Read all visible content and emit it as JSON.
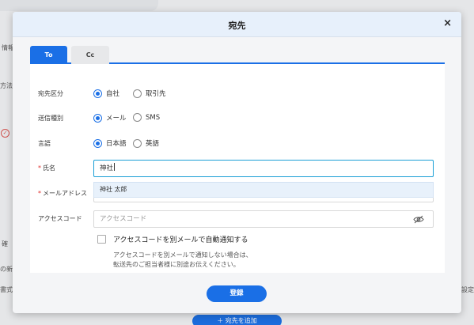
{
  "background": {
    "left_texts": [
      "情報",
      "方法",
      "確",
      "の新",
      "書式"
    ],
    "right_text": "設定",
    "add_recipient_label": "＋ 宛先を追加"
  },
  "dialog": {
    "title": "宛先",
    "close_label": "×",
    "tabs": [
      {
        "label": "To",
        "active": true
      },
      {
        "label": "Cc",
        "active": false
      }
    ],
    "recipient_type": {
      "label": "宛先区分",
      "options": [
        {
          "label": "自社",
          "checked": true
        },
        {
          "label": "取引先",
          "checked": false
        }
      ]
    },
    "send_type": {
      "label": "送信種別",
      "options": [
        {
          "label": "メール",
          "checked": true
        },
        {
          "label": "SMS",
          "checked": false
        }
      ]
    },
    "language": {
      "label": "言語",
      "options": [
        {
          "label": "日本語",
          "checked": true
        },
        {
          "label": "英語",
          "checked": false
        }
      ]
    },
    "name": {
      "required_mark": "*",
      "label": "氏名",
      "value": "神社",
      "suggestion": "神社 太郎"
    },
    "email": {
      "required_mark": "*",
      "label": "メールアドレス"
    },
    "access_code": {
      "label": "アクセスコード",
      "placeholder": "アクセスコード"
    },
    "auto_notify": {
      "label": "アクセスコードを別メールで自動通知する",
      "checked": false,
      "note_line1": "アクセスコードを別メールで通知しない場合は、",
      "note_line2": "転送先のご担当者様に別途お伝えください。"
    },
    "submit_label": "登録"
  },
  "colors": {
    "primary": "#1a6fe6",
    "required": "#e0312f",
    "header_bg": "#e7f0fb",
    "suggestion_bg": "#e8f1fb"
  }
}
